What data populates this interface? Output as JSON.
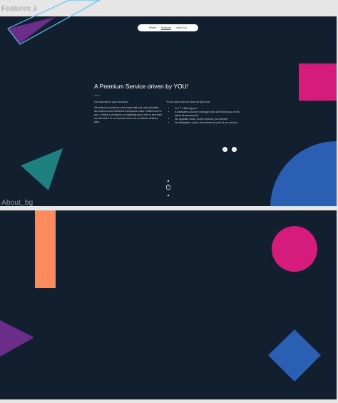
{
  "frames": {
    "features3": {
      "label": "Features 3"
    },
    "about_bg": {
      "label": "About_bg"
    }
  },
  "nav": {
    "items": [
      "Pillars",
      "Features",
      "About Us"
    ],
    "active": "Features"
  },
  "content": {
    "heading": "A Premium Service driven by YOU!",
    "left_paragraphs": [
      "Our success is your success.",
      "We share our product road maps with you and prioritise the features and functions that would make a difference to you. If there is a feature or capability you'd like to see then we will add it to our list and work out a realistic delivery plan."
    ],
    "right_intro": "To put your mind at ease we give you:",
    "right_bullets": [
      "24 / 7 / 365 support",
      "A dedicated account manager who will inform you of the latest developments",
      "No upgrade costs, as we improve you benefit",
      "No integration costs, all covered as part of our service"
    ]
  },
  "icons": {
    "prev": "arrow-left-icon",
    "next": "arrow-right-icon",
    "scroll": "mouse-scroll-icon"
  },
  "colors": {
    "background": "#121f2e",
    "purple": "#6b2d8a",
    "teal": "#1f8080",
    "pink": "#d51b7b",
    "blue": "#2a5fb3",
    "orange": "#ff8a5b",
    "selection": "#5bc4f5"
  }
}
